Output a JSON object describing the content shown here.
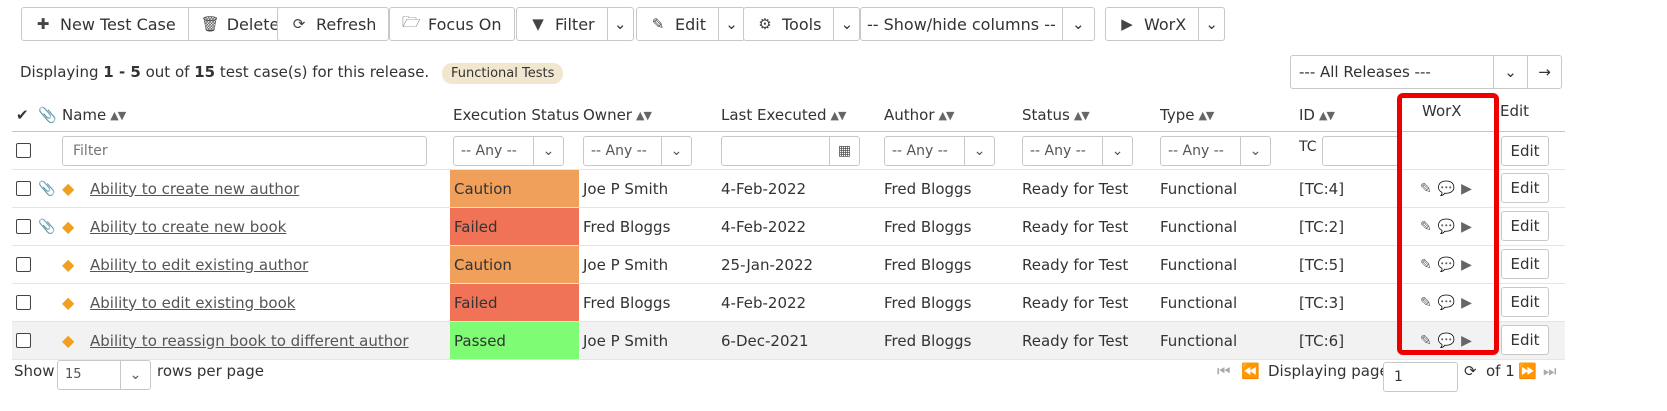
{
  "toolbar": {
    "new_test_case": "New Test Case",
    "delete": "Delete",
    "refresh": "Refresh",
    "focus_on": "Focus On",
    "filter": "Filter",
    "edit": "Edit",
    "tools": "Tools",
    "columns": "-- Show/hide columns --",
    "worx": "WorX"
  },
  "info": {
    "prefix": "Displaying",
    "range": "1 - 5",
    "mid": "out of",
    "total": "15",
    "suffix": "test case(s) for this release.",
    "badge": "Functional Tests"
  },
  "releases": {
    "selected": "--- All Releases ---"
  },
  "headers": {
    "name": "Name",
    "execution_status": "Execution Status",
    "owner": "Owner",
    "last_executed": "Last Executed",
    "author": "Author",
    "status": "Status",
    "type": "Type",
    "id": "ID",
    "worx": "WorX",
    "edit": "Edit"
  },
  "filters": {
    "name_placeholder": "Filter",
    "any": "-- Any --",
    "id_prefix": "TC",
    "edit": "Edit"
  },
  "rows": [
    {
      "attach": true,
      "name": "Ability to create new author",
      "exec": "Caution",
      "exec_color": "#f0a05a",
      "owner": "Joe P Smith",
      "last": "4-Feb-2022",
      "author": "Fred Bloggs",
      "status": "Ready for Test",
      "type": "Functional",
      "id": "[TC:4]",
      "edit": "Edit"
    },
    {
      "attach": true,
      "name": "Ability to create new book",
      "exec": "Failed",
      "exec_color": "#f07358",
      "owner": "Fred Bloggs",
      "last": "4-Feb-2022",
      "author": "Fred Bloggs",
      "status": "Ready for Test",
      "type": "Functional",
      "id": "[TC:2]",
      "edit": "Edit"
    },
    {
      "attach": false,
      "name": "Ability to edit existing author",
      "exec": "Caution",
      "exec_color": "#f0a05a",
      "owner": "Joe P Smith",
      "last": "25-Jan-2022",
      "author": "Fred Bloggs",
      "status": "Ready for Test",
      "type": "Functional",
      "id": "[TC:5]",
      "edit": "Edit"
    },
    {
      "attach": false,
      "name": "Ability to edit existing book",
      "exec": "Failed",
      "exec_color": "#f07358",
      "owner": "Fred Bloggs",
      "last": "4-Feb-2022",
      "author": "Fred Bloggs",
      "status": "Ready for Test",
      "type": "Functional",
      "id": "[TC:3]",
      "edit": "Edit"
    },
    {
      "attach": false,
      "name": "Ability to reassign book to different author",
      "exec": "Passed",
      "exec_color": "#7dfc74",
      "owner": "Joe P Smith",
      "last": "6-Dec-2021",
      "author": "Fred Bloggs",
      "status": "Ready for Test",
      "type": "Functional",
      "id": "[TC:6]",
      "edit": "Edit"
    }
  ],
  "footer": {
    "show": "Show",
    "page_size": "15",
    "rows_per_page": "rows per page",
    "displaying_page": "Displaying page",
    "page": "1",
    "of": "of 1"
  },
  "colors": {
    "highlight": "#ee0000",
    "header_rule": "#e9c46a",
    "badge_bg": "#f1e7cf"
  }
}
